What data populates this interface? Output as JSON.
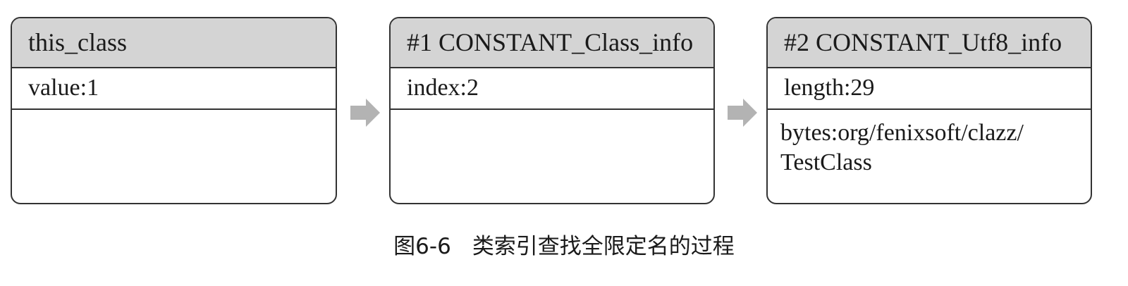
{
  "boxes": [
    {
      "header": "this_class",
      "row": "value:1",
      "body_lines": []
    },
    {
      "header": "#1 CONSTANT_Class_info",
      "row": "index:2",
      "body_lines": []
    },
    {
      "header": "#2 CONSTANT_Utf8_info",
      "row": "length:29",
      "body_lines": [
        "bytes:org/fenixsoft/clazz/",
        "TestClass"
      ]
    }
  ],
  "caption": {
    "figure_number": "图6-6",
    "text": "类索引查找全限定名的过程"
  },
  "colors": {
    "header_fill": "#d4d4d4",
    "border": "#333333",
    "arrow": "#b3b3b3"
  }
}
